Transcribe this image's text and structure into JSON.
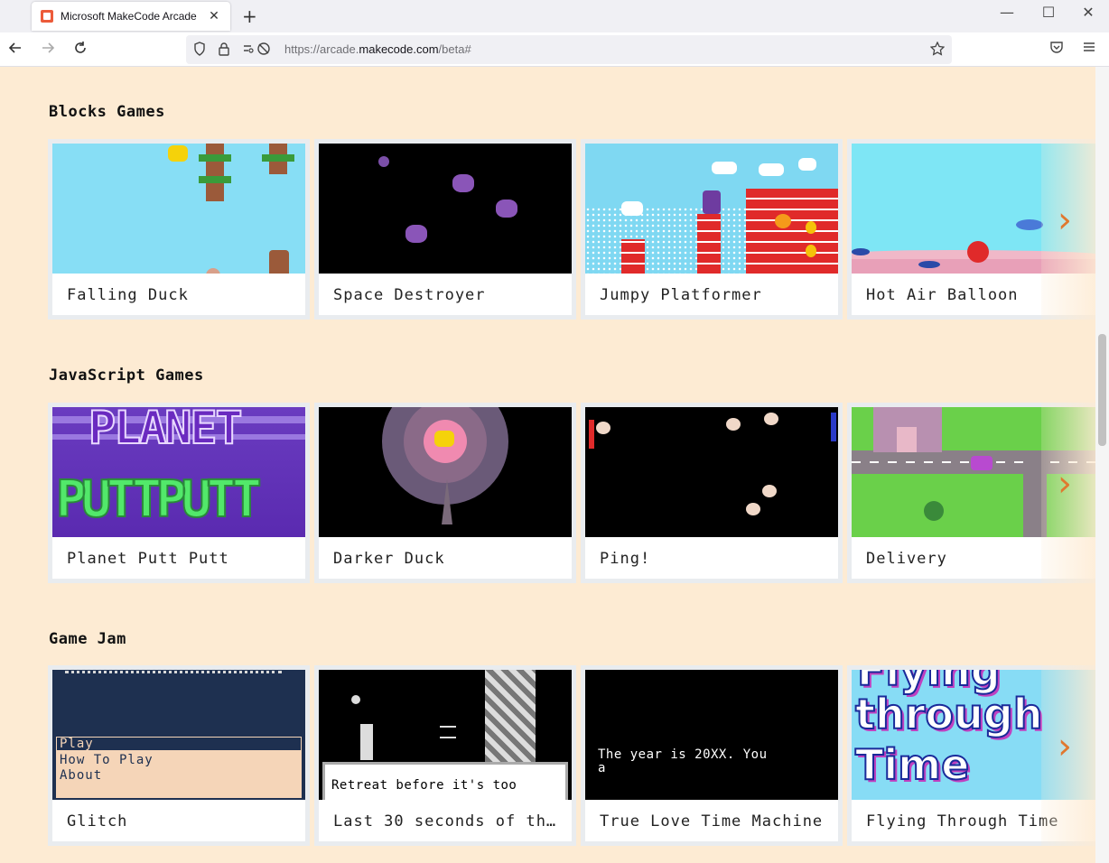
{
  "browser": {
    "tab_title": "Microsoft MakeCode Arcade",
    "tab_close": "✕",
    "new_tab": "+",
    "url_prefix": "https://arcade.",
    "url_domain": "makecode.com",
    "url_suffix": "/beta#",
    "window_controls": {
      "minimize": "—",
      "maximize": "☐",
      "close": "✕"
    }
  },
  "icons": {
    "back": "arrow-left-icon",
    "forward": "arrow-right-icon",
    "reload": "reload-icon",
    "shield": "shield-icon",
    "lock": "lock-icon",
    "permissions": "permissions-icon",
    "bookmark": "star-icon",
    "pocket": "pocket-icon",
    "menu": "hamburger-menu-icon"
  },
  "sections": [
    {
      "title": "Blocks Games",
      "cards": [
        "Falling Duck",
        "Space Destroyer",
        "Jumpy Platformer",
        "Hot Air Balloon"
      ]
    },
    {
      "title": "JavaScript Games",
      "cards": [
        "Planet Putt Putt",
        "Darker Duck",
        "Ping!",
        "Delivery"
      ]
    },
    {
      "title": "Game Jam",
      "cards": [
        "Glitch",
        "Last 30 seconds of th…",
        "True Love Time Machine",
        "Flying Through Time"
      ]
    }
  ],
  "thumbs": {
    "planet_line1": "PLANET",
    "planet_line2": "PUTTPUTT",
    "glitch_menu": [
      "Play",
      "How To Play",
      "About"
    ],
    "last30_dialog": "Retreat before it's too",
    "truelove_text1": "The year is 20XX. You",
    "truelove_text2": "a",
    "flying_line1": "Flying",
    "flying_line2": "through",
    "flying_line3": "Time"
  },
  "chevron": "›",
  "colors": {
    "page_bg": "#fdebd3",
    "accent": "#e0782f"
  }
}
